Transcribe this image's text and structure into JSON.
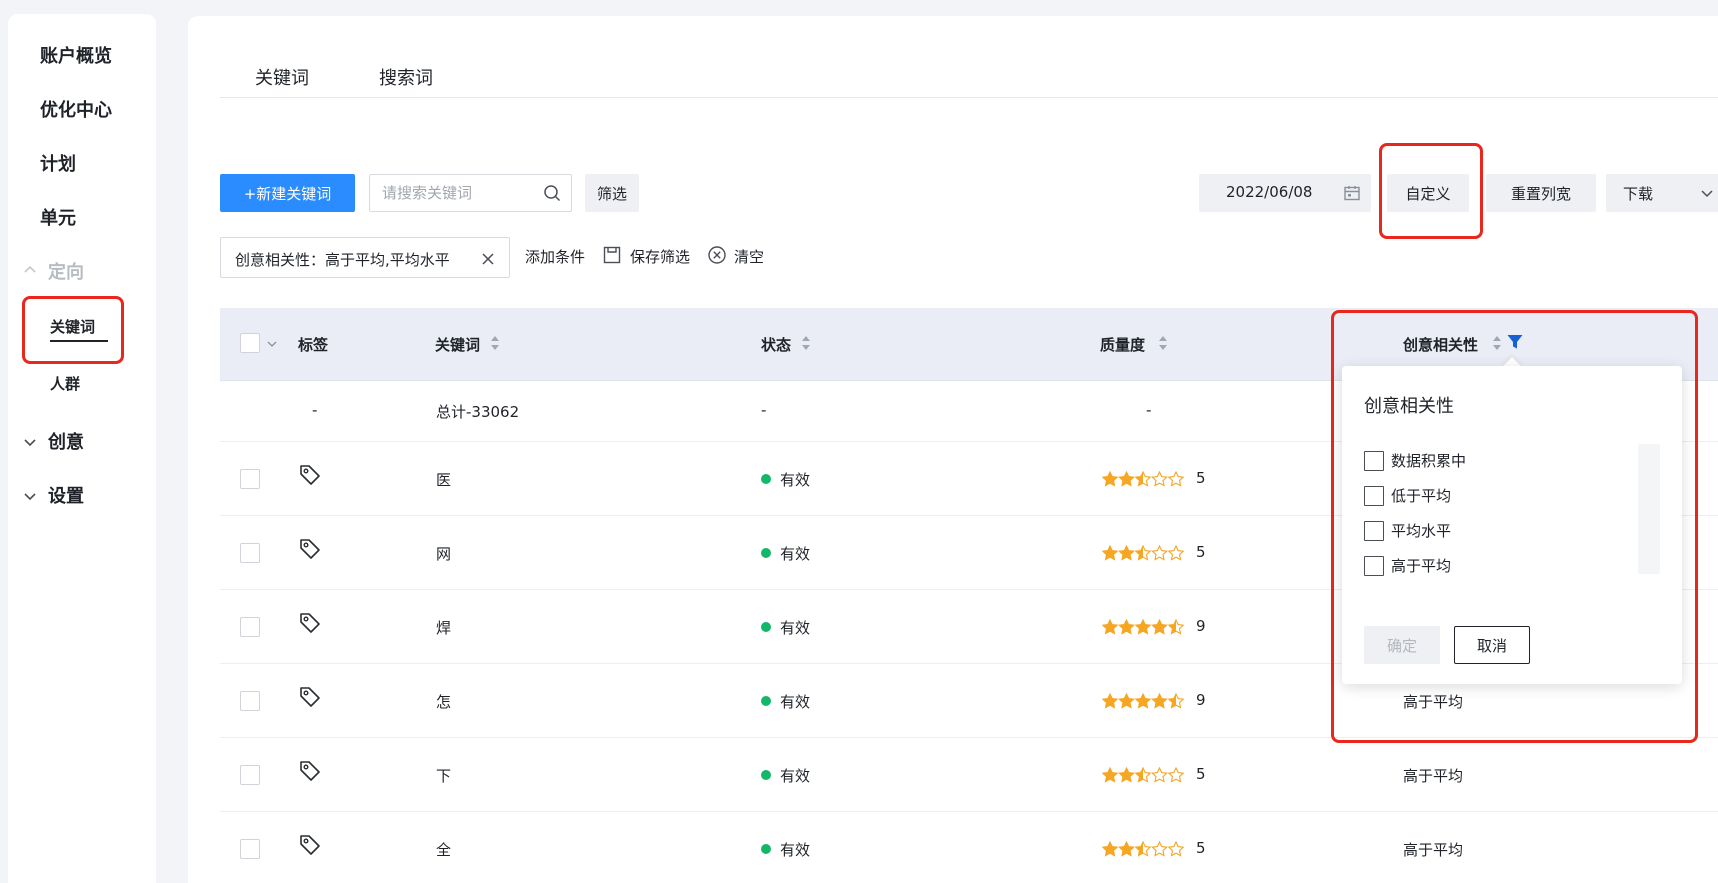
{
  "sidebar": {
    "items": [
      {
        "label": "账户概览"
      },
      {
        "label": "优化中心"
      },
      {
        "label": "计划"
      },
      {
        "label": "单元"
      },
      {
        "label": "定向"
      },
      {
        "label": "关键词"
      },
      {
        "label": "人群"
      },
      {
        "label": "创意"
      },
      {
        "label": "设置"
      }
    ]
  },
  "tabs": [
    {
      "label": "关键词"
    },
    {
      "label": "搜索词"
    }
  ],
  "toolbar": {
    "new_keyword": "+新建关键词",
    "search_placeholder": "请搜索关键词",
    "filter": "筛选",
    "date": "2022/06/08",
    "custom": "自定义",
    "reset_width": "重置列宽",
    "download": "下载"
  },
  "filters": {
    "chip": "创意相关性：高于平均,平均水平",
    "add_condition": "添加条件",
    "save_filter": "保存筛选",
    "clear": "清空"
  },
  "table": {
    "columns": [
      "标签",
      "关键词",
      "状态",
      "质量度",
      "创意相关性"
    ],
    "summary": {
      "tag": "-",
      "keyword": "总计-33062",
      "status": "-",
      "quality": "-"
    },
    "rows": [
      {
        "keyword": "医",
        "status": "有效",
        "stars": 2.5,
        "quality": "5",
        "relevance": ""
      },
      {
        "keyword": "网",
        "status": "有效",
        "stars": 2.5,
        "quality": "5",
        "relevance": ""
      },
      {
        "keyword": "焊",
        "status": "有效",
        "stars": 4.5,
        "quality": "9",
        "relevance": ""
      },
      {
        "keyword": "怎",
        "status": "有效",
        "stars": 4.5,
        "quality": "9",
        "relevance": "高于平均"
      },
      {
        "keyword": "下",
        "status": "有效",
        "stars": 2.5,
        "quality": "5",
        "relevance": "高于平均"
      },
      {
        "keyword": "全",
        "status": "有效",
        "stars": 2.5,
        "quality": "5",
        "relevance": "高于平均"
      }
    ]
  },
  "filter_popup": {
    "title": "创意相关性",
    "options": [
      "数据积累中",
      "低于平均",
      "平均水平",
      "高于平均"
    ],
    "confirm": "确定",
    "cancel": "取消"
  },
  "colors": {
    "primary": "#2b8cff",
    "highlight": "#e8271d",
    "status_ok": "#12b76a",
    "star": "#f5a623",
    "filter_active": "#1660d6"
  }
}
